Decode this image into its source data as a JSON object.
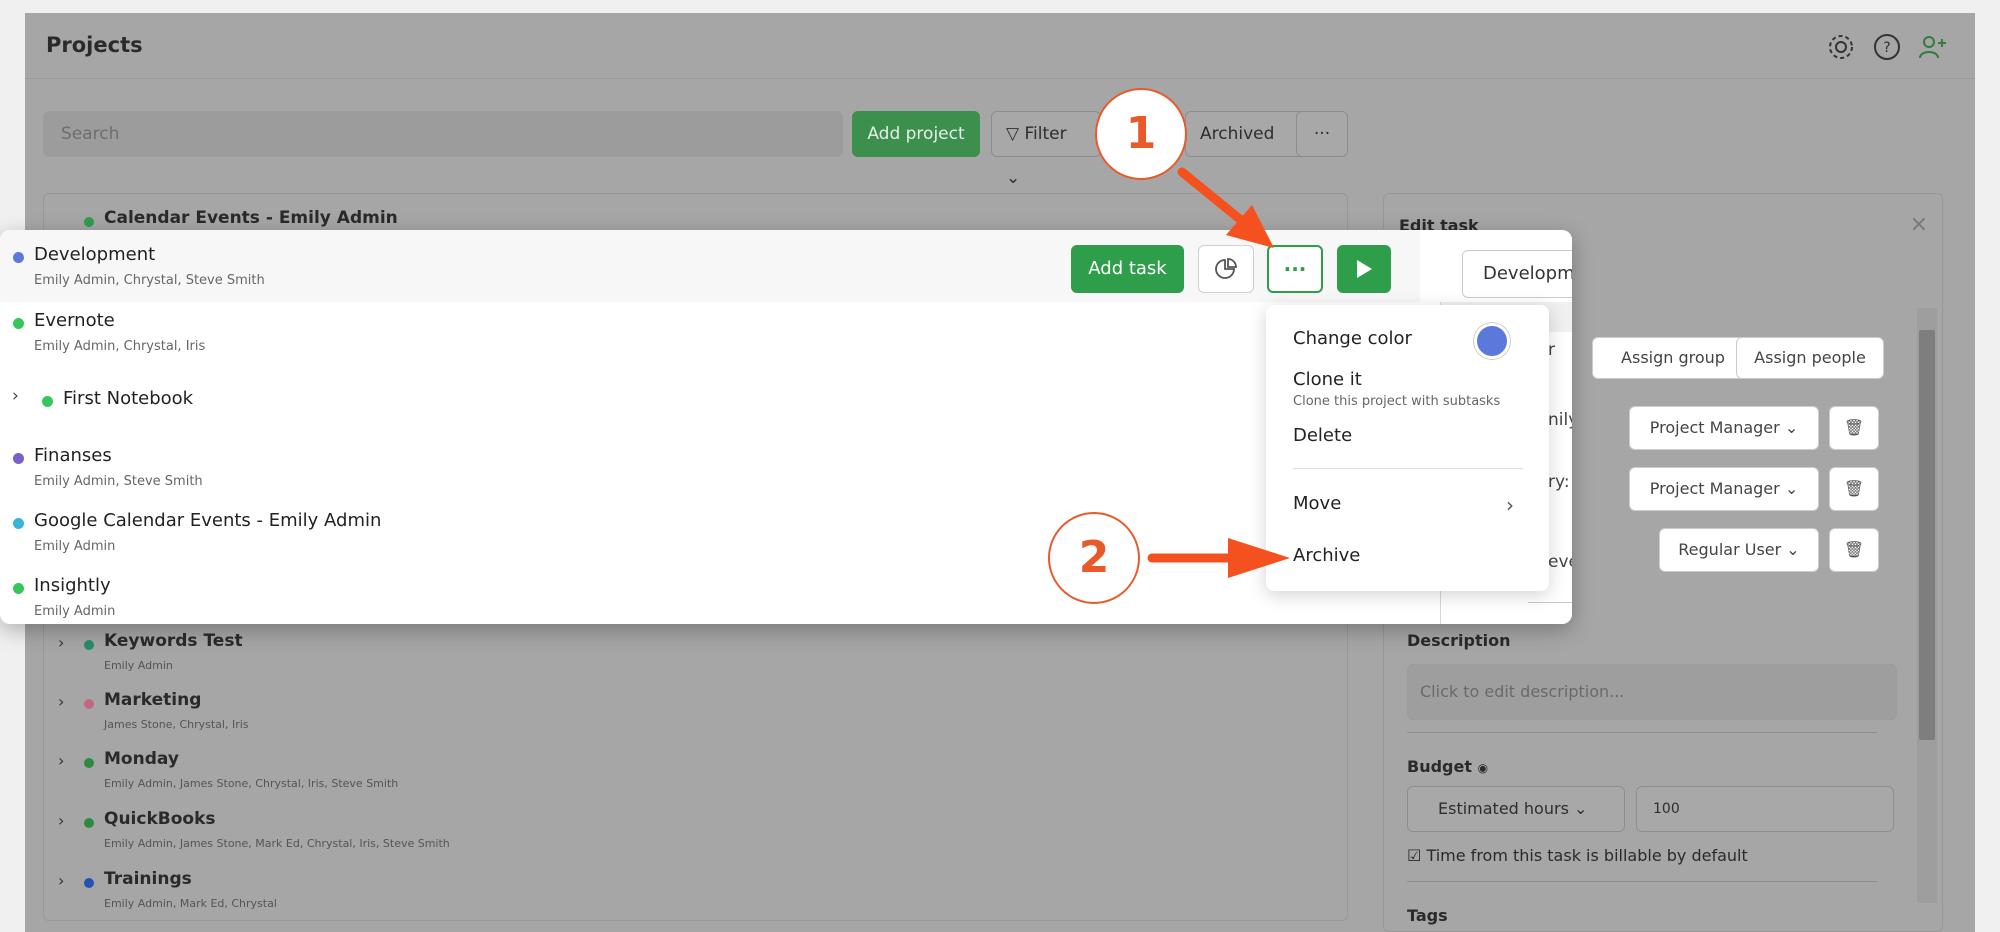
{
  "header": {
    "title": "Projects"
  },
  "toolbar": {
    "search_placeholder": "Search",
    "add_project": "Add project",
    "filter": "Filter",
    "archived": "Archived",
    "more": "···"
  },
  "background_projects": [
    {
      "name": "Calendar Events - Emily Admin",
      "color": "#2e9e4a"
    },
    {
      "name": "Keywords Test",
      "members": "Emily Admin",
      "color": "#2a8a6a"
    },
    {
      "name": "Marketing",
      "members": "James Stone, Chrystal, Iris",
      "color": "#d46a8a"
    },
    {
      "name": "Monday",
      "members": "Emily Admin, James Stone, Chrystal, Iris, Steve Smith",
      "color": "#2e9e4a"
    },
    {
      "name": "QuickBooks",
      "members": "Emily Admin, James Stone, Mark Ed, Chrystal, Iris, Steve Smith",
      "color": "#2e9e4a"
    },
    {
      "name": "Trainings",
      "members": "Emily Admin, Mark Ed, Chrystal",
      "color": "#2b5fd6"
    }
  ],
  "highlighted_projects": [
    {
      "name": "Development",
      "members": "Emily Admin, Chrystal, Steve Smith",
      "color": "#5b79db"
    },
    {
      "name": "Evernote",
      "members": "Emily Admin, Chrystal, Iris",
      "color": "#34c759"
    },
    {
      "name": "First Notebook",
      "members": "",
      "color": "#34c759"
    },
    {
      "name": "Finanses",
      "members": "Emily Admin, Steve Smith",
      "color": "#7a5fc9"
    },
    {
      "name": "Google Calendar Events - Emily Admin",
      "members": "Emily Admin",
      "color": "#38b4d9"
    },
    {
      "name": "Insightly",
      "members": "Emily Admin",
      "color": "#34c759"
    }
  ],
  "row_actions": {
    "add_task": "Add task",
    "more": "···"
  },
  "menu": {
    "change_color": "Change color",
    "swatch_color": "#5b79db",
    "clone": "Clone it",
    "clone_sub": "Clone this project with subtasks",
    "delete": "Delete",
    "move": "Move",
    "archive": "Archive"
  },
  "edit_task": {
    "title": "Edit task",
    "name_value": "Developm",
    "assign_group": "Assign group",
    "assign_people": "Assign people",
    "people": [
      {
        "frag_in_popup": "nily",
        "role": "Project Manager"
      },
      {
        "frag_in_popup": "ry:",
        "role": "Project Manager"
      },
      {
        "frag_in_popup": "eve",
        "role": "Regular User"
      }
    ],
    "assign_frag": "r",
    "description_label": "Description",
    "description_placeholder": "Click to edit description...",
    "budget_label": "Budget",
    "budget_type": "Estimated hours",
    "budget_value": "100",
    "billable": "Time from this task is billable by default",
    "tags_label": "Tags"
  },
  "annotations": {
    "step1": "1",
    "step2": "2"
  }
}
